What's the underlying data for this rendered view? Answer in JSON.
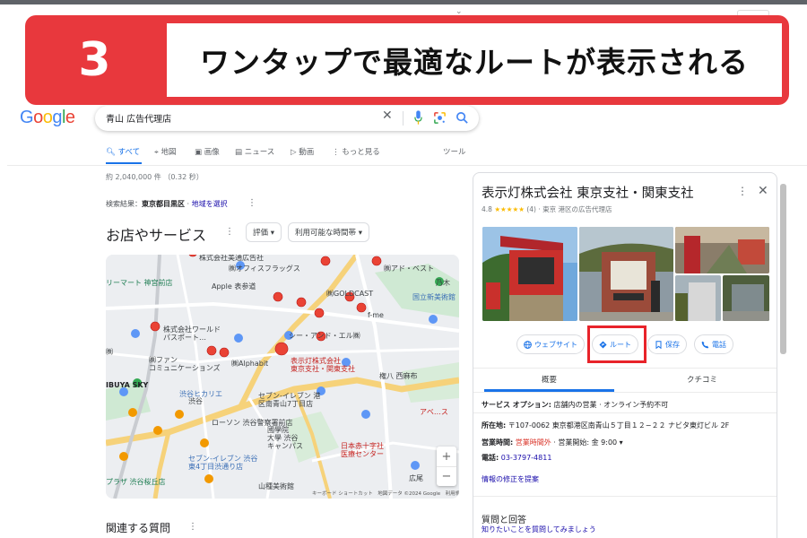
{
  "ghost_search": "",
  "banner": {
    "step_number": "3",
    "headline": "ワンタップで最適なルートが表示される"
  },
  "google": {
    "logo_letters": [
      "G",
      "o",
      "o",
      "g",
      "l",
      "e"
    ],
    "logo_colors": [
      "#4285f4",
      "#ea4335",
      "#fbbc05",
      "#4285f4",
      "#34a853",
      "#ea4335"
    ],
    "query": "青山 広告代理店",
    "tabs": [
      "すべて",
      "地図",
      "画像",
      "ニュース",
      "動画",
      "もっと見る"
    ],
    "tools": "ツール",
    "result_stats": "約 2,040,000 件 （0.32 秒）",
    "location": {
      "prefix": "検索結果：",
      "area": "東京都目黒区",
      "sep": " · ",
      "link": "地域を選択"
    },
    "section_title": "お店やサービス",
    "chips": [
      "評価 ▾",
      "利用可能な時間帯 ▾"
    ],
    "related_title": "関連する質問"
  },
  "map": {
    "labels": {
      "l1": "株式会社美通広告社",
      "l2": "㈱オフィスフラッグス",
      "l3": "㈱アド・ベスト",
      "l4": "リーマート 神宮前店",
      "l5": "Apple 表参道",
      "l6": "乃木",
      "l7": "㈱GOLDCAST",
      "l8": "国立新美術館",
      "l9": "f-me",
      "l10": "株式会社ワールド\nパスポート…",
      "l11": "シー・アンド・エル㈱",
      "l12": "㈱ファン\nコミュニケーションズ",
      "l13": "㈱Alphabit",
      "l14": "表示灯株式会社\n東京支社・関東支社",
      "l15": "権八 西麻布",
      "l16": "IBUYA SKY",
      "l17": "渋谷ヒカリエ",
      "l18": "セブン-イレブン 港\n区南青山7丁目店",
      "l19": "アベ…ス",
      "l20": "ローソン 渋谷警察署前店",
      "l21": "國學院\n大學 渋谷\nキャンパス",
      "l22": "日本赤十字社\n医療センター",
      "l23": "セブン-イレブン 渋谷\n東4丁目渋通り店",
      "l24": "山種美術館",
      "l25": "広尾",
      "l26": "プラザ 渋谷桜丘店",
      "l27": "渋谷",
      "l28": "㈱"
    },
    "attribution": "キーボード ショートカット　地図データ ©2024 Google　利用規約",
    "zoom_in": "+",
    "zoom_out": "−"
  },
  "panel": {
    "title": "表示灯株式会社 東京支社・関東支社",
    "rating": "4.8",
    "stars": "★★★★★",
    "reviews": "(4)",
    "category": " · 東京 港区の広告代理店",
    "buttons": [
      "ウェブサイト",
      "ルート",
      "保存",
      "電話"
    ],
    "tabs": [
      "概要",
      "クチコミ"
    ],
    "service_label": "サービス オプション:",
    "service_value": " 店舗内の営業 · オンライン予約不可",
    "address_label": "所在地:",
    "address_value": " 〒107-0062 東京都港区南青山５丁目１２−２２ ナビタ東灯ビル 2F",
    "hours_label": "営業時間:",
    "hours_closed": " 営業時間外",
    "hours_open": " · 営業開始: 金 9:00 ▾",
    "phone_label": "電話:",
    "phone_value": " 03-3797-4811",
    "suggest_edit": "情報の修正を提案",
    "qa_title": "質問と回答",
    "qa_link": "知りたいことを質問してみましょう"
  },
  "colors": {
    "banner_red": "#e8383d",
    "link_blue": "#1a0dab",
    "accent_blue": "#1a73e8",
    "highlight_red": "#e8232a",
    "pin_red": "#ea4335"
  }
}
